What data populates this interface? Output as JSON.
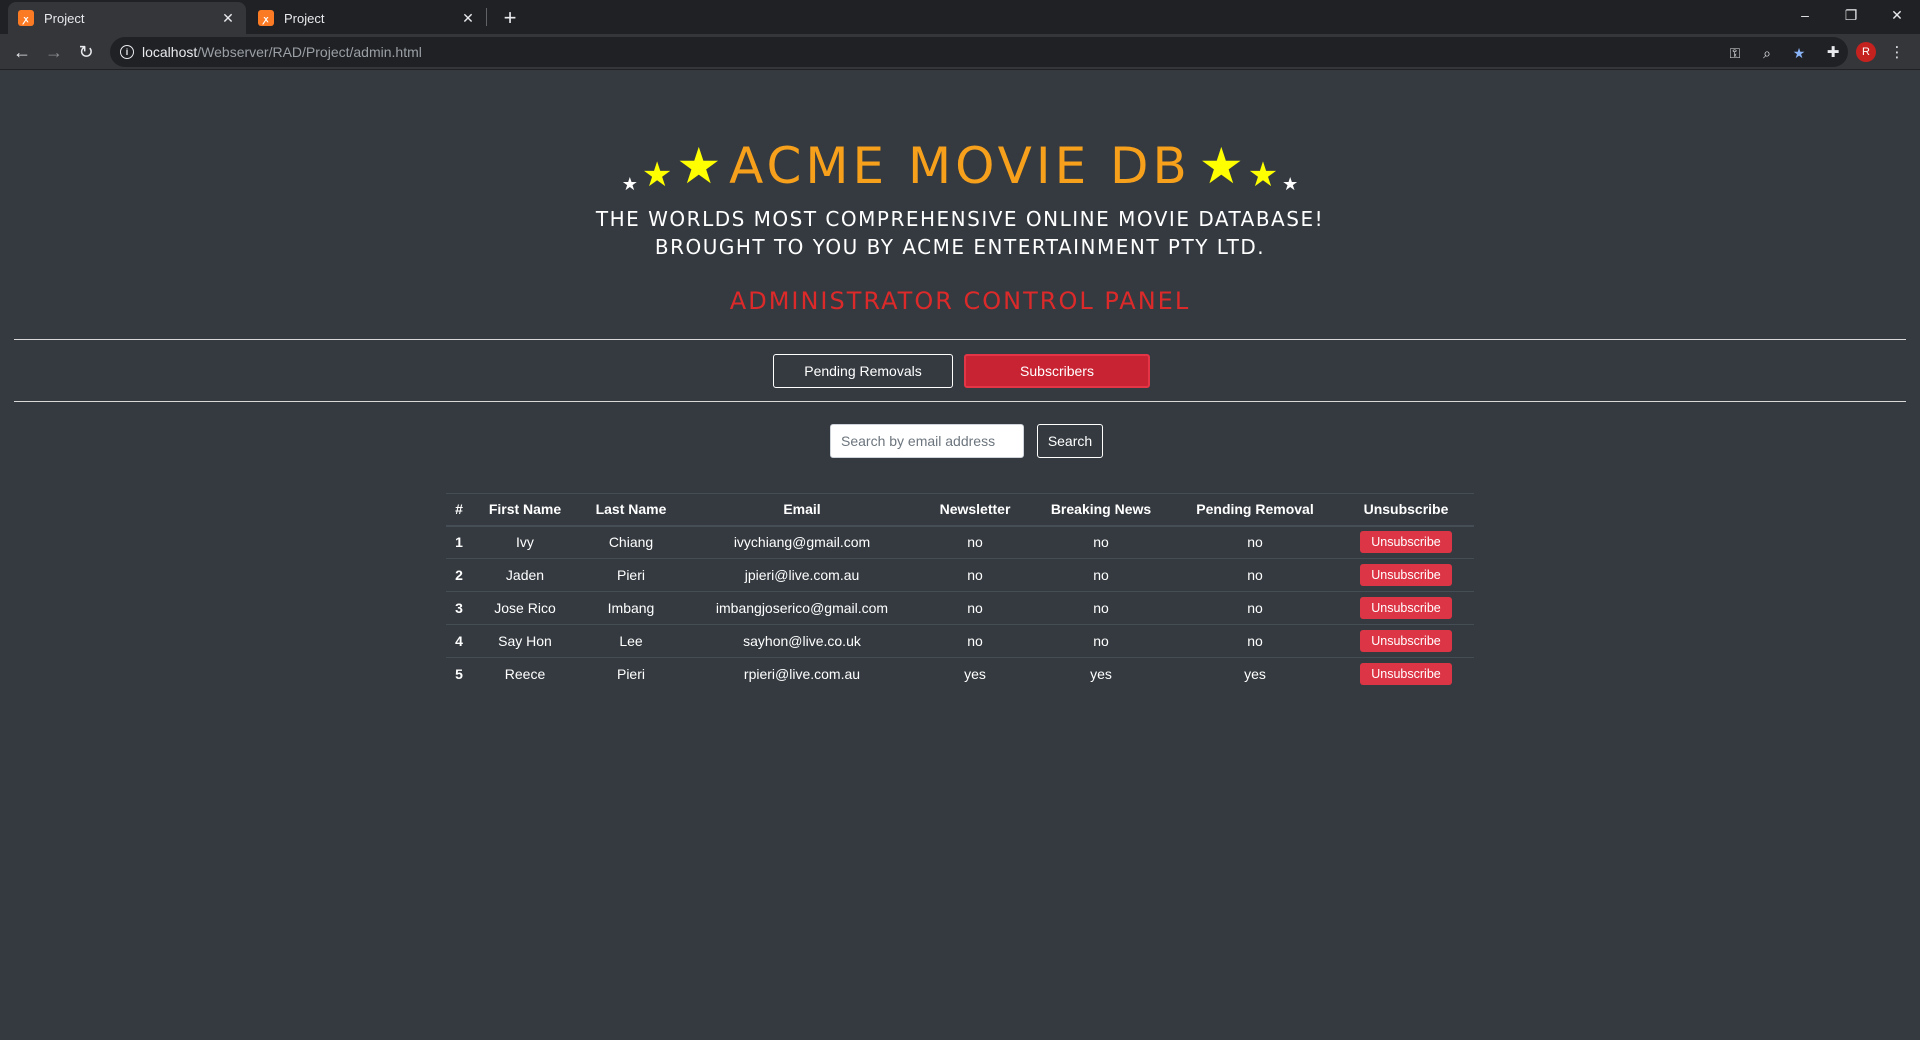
{
  "browser": {
    "tabs": [
      {
        "title": "Project",
        "active": true
      },
      {
        "title": "Project",
        "active": false
      }
    ],
    "url_host": "localhost",
    "url_path": "/Webserver/RAD/Project/admin.html",
    "profile_initial": "R"
  },
  "header": {
    "title": "ACME MOVIE DB",
    "tagline_line1": "THE WORLDS MOST COMPREHENSIVE ONLINE MOVIE DATABASE!",
    "tagline_line2": "BROUGHT TO YOU BY ACME ENTERTAINMENT PTY LTD.",
    "panel_title": "ADMINISTRATOR CONTROL PANEL"
  },
  "nav": {
    "pending_label": "Pending Removals",
    "subscribers_label": "Subscribers",
    "active": "Subscribers"
  },
  "search": {
    "placeholder": "Search by email address",
    "value": "",
    "button_label": "Search"
  },
  "table": {
    "headers": [
      "#",
      "First Name",
      "Last Name",
      "Email",
      "Newsletter",
      "Breaking News",
      "Pending Removal",
      "Unsubscribe"
    ],
    "button_label": "Unsubscribe",
    "rows": [
      {
        "num": "1",
        "first": "Ivy",
        "last": "Chiang",
        "email": "ivychiang@gmail.com",
        "newsletter": "no",
        "breaking": "no",
        "pending": "no"
      },
      {
        "num": "2",
        "first": "Jaden",
        "last": "Pieri",
        "email": "jpieri@live.com.au",
        "newsletter": "no",
        "breaking": "no",
        "pending": "no"
      },
      {
        "num": "3",
        "first": "Jose Rico",
        "last": "Imbang",
        "email": "imbangjoserico@gmail.com",
        "newsletter": "no",
        "breaking": "no",
        "pending": "no"
      },
      {
        "num": "4",
        "first": "Say Hon",
        "last": "Lee",
        "email": "sayhon@live.co.uk",
        "newsletter": "no",
        "breaking": "no",
        "pending": "no"
      },
      {
        "num": "5",
        "first": "Reece",
        "last": "Pieri",
        "email": "rpieri@live.com.au",
        "newsletter": "yes",
        "breaking": "yes",
        "pending": "yes"
      }
    ]
  },
  "colors": {
    "background": "#343a40",
    "title": "#f7a01c",
    "panel_title": "#dc2a2a",
    "danger": "#dc3545",
    "star": "#ffff00"
  }
}
